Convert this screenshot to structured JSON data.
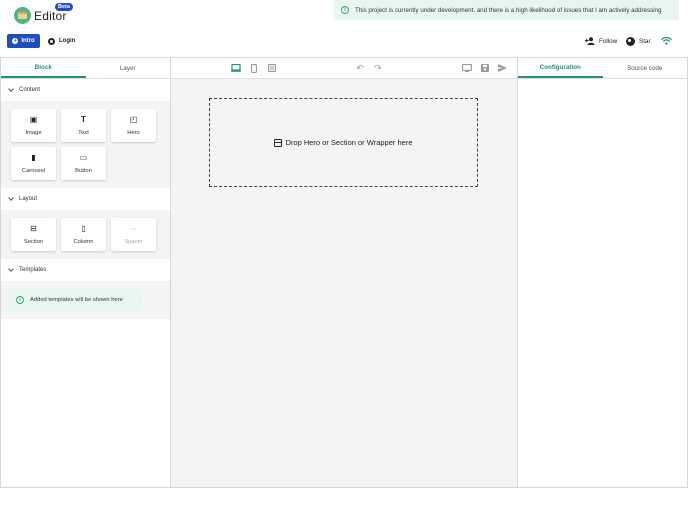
{
  "header": {
    "brand": "Editor",
    "badge": "Beta",
    "notice": "This project is currently under development, and there is a high likelihood of issues that I am actively addressing",
    "intro_label": "Intro",
    "login_label": "Login",
    "follow_label": "Follow",
    "star_label": "Star"
  },
  "left_panel": {
    "tabs": [
      {
        "label": "Block",
        "active": true
      },
      {
        "label": "Layer",
        "active": false
      }
    ],
    "sections": {
      "content": {
        "title": "Content",
        "blocks": [
          {
            "label": "Image",
            "icon": "image-icon"
          },
          {
            "label": "Text",
            "icon": "text-icon"
          },
          {
            "label": "Hero",
            "icon": "hero-icon"
          },
          {
            "label": "Carousel",
            "icon": "carousel-icon"
          },
          {
            "label": "Button",
            "icon": "button-icon"
          }
        ]
      },
      "layout": {
        "title": "Layout",
        "blocks": [
          {
            "label": "Section",
            "icon": "section-icon"
          },
          {
            "label": "Column",
            "icon": "column-icon"
          },
          {
            "label": "Spacer",
            "icon": "spacer-icon",
            "disabled": true
          }
        ]
      },
      "templates": {
        "title": "Templates",
        "note": "Added templates will be shown here"
      }
    }
  },
  "canvas": {
    "dropzone_text": "Drop Hero or Section or Wrapper here"
  },
  "right_panel": {
    "tabs": [
      {
        "label": "Configuration",
        "active": true
      },
      {
        "label": "Source code",
        "active": false
      }
    ]
  },
  "colors": {
    "accent": "#23946a",
    "primary": "#1f4fbf",
    "notice_bg": "#e8f6f0",
    "canvas_bg": "#f4f4f4"
  }
}
